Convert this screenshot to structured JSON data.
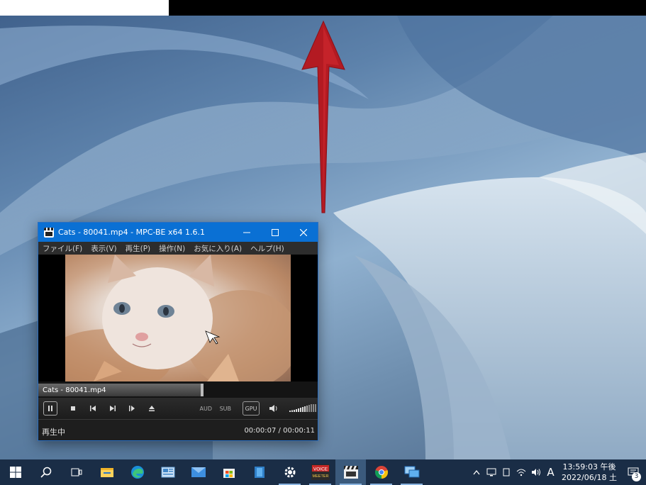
{
  "player": {
    "window_title": "Cats - 80041.mp4 - MPC-BE x64 1.6.1",
    "menu": [
      "ファイル(F)",
      "表示(V)",
      "再生(P)",
      "操作(N)",
      "お気に入り(A)",
      "ヘルプ(H)"
    ],
    "seek_filename": "Cats - 80041.mp4",
    "playback_progress": 0.64,
    "audio_toggle": "AUD",
    "sub_toggle": "SUB",
    "gpu_label": "GPU",
    "status": "再生中",
    "time": "00:00:07 / 00:00:11"
  },
  "taskbar": {
    "icons": [
      "windows-start-icon",
      "search-icon",
      "task-view-icon",
      "file-explorer-icon",
      "edge-icon",
      "news-icon",
      "mail-icon",
      "store-icon",
      "files-icon",
      "settings-icon",
      "voicemeeter-icon",
      "mpc-be-icon",
      "chrome-icon",
      "remote-desktop-icon"
    ],
    "voicemeeter_label_1": "VOICE",
    "voicemeeter_label_2": "MEETER",
    "clock_time": "13:59:03 午後",
    "clock_date": "2022/06/18 土",
    "ime_indicator": "A",
    "notification_count": "3"
  }
}
